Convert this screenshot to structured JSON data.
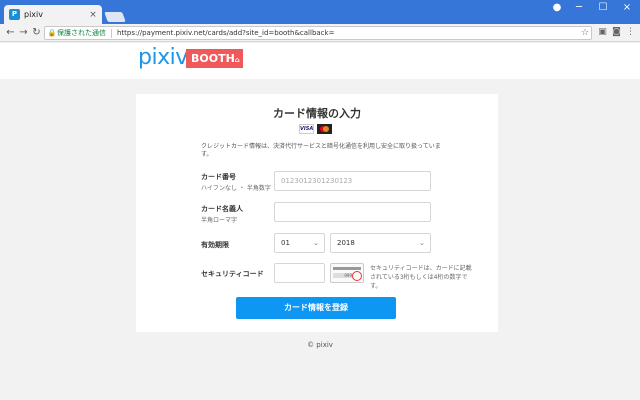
{
  "browser": {
    "tab_title": "pixiv",
    "tab_favicon": "P",
    "secure_label": "保護された通信",
    "url": "https://payment.pixiv.net/cards/add?site_id=booth&callback=",
    "close_glyph": "×",
    "minimize_glyph": "─",
    "maximize_glyph": "☐",
    "account_glyph": "●",
    "back_glyph": "←",
    "forward_glyph": "→",
    "reload_glyph": "↻",
    "lock_glyph": "🔒",
    "star_glyph": "☆",
    "menu_glyph": "⋮",
    "ext1_glyph": "▣",
    "ext2_glyph": "◙"
  },
  "header": {
    "pixiv_logo": "pixiv",
    "booth_logo": "BOOTH",
    "booth_house": "⌂"
  },
  "form": {
    "title": "カード情報の入力",
    "visa_logo": "VISA",
    "notice": "クレジットカード情報は、決済代行サービスと暗号化通信を利用し安全に取り扱っています。",
    "card_number_label": "カード番号",
    "card_number_sublabel": "ハイフンなし ・ 半角数字",
    "card_number_placeholder": "0123012301230123",
    "name_label": "カード名義人",
    "name_sublabel": "半角ローマ字",
    "name_value": "",
    "expiry_label": "有効期限",
    "expiry_month": "01",
    "expiry_year": "2018",
    "chevron": "⌄",
    "cvv_label": "セキュリティコード",
    "cvv_value": "",
    "cvv_sample": "999",
    "cvv_help": "セキュリティコードは、カードに記載されている3桁もしくは4桁の数字です。",
    "submit_label": "カード情報を登録"
  },
  "footer": {
    "copyright": "© pixiv"
  },
  "colors": {
    "chrome_blue": "#3576d8",
    "pixiv_blue": "#1e96e8",
    "booth_red": "#f0595a",
    "submit_blue": "#0d96f2"
  }
}
